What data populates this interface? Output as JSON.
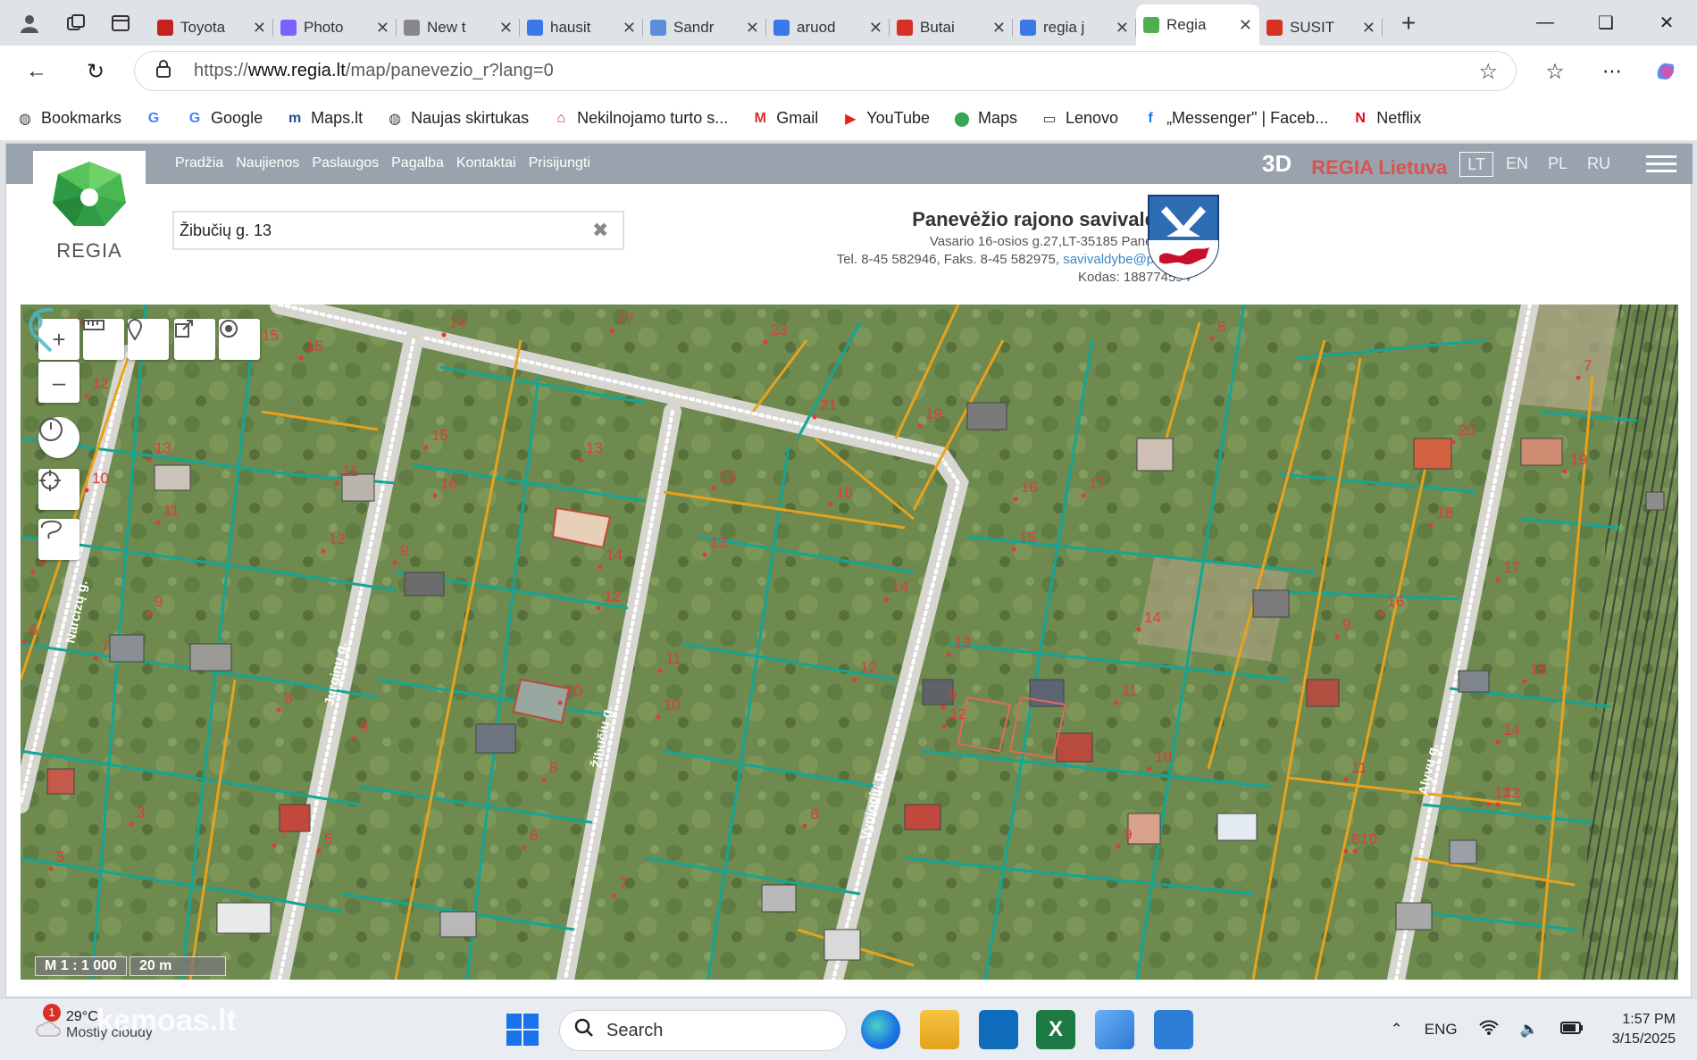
{
  "browser": {
    "tabs": [
      {
        "title": "Toyota",
        "fav": "#c5221f"
      },
      {
        "title": "Photo",
        "fav": "#7b61ff"
      },
      {
        "title": "New t",
        "fav": "#888888"
      },
      {
        "title": "hausit",
        "fav": "#3b78e7"
      },
      {
        "title": "Sandr",
        "fav": "#5a8fd8"
      },
      {
        "title": "aruod",
        "fav": "#3b78e7"
      },
      {
        "title": "Butai",
        "fav": "#d93025"
      },
      {
        "title": "regia j",
        "fav": "#3b78e7"
      },
      {
        "title": "Regia",
        "fav": "#4caf50"
      },
      {
        "title": "SUSIT",
        "fav": "#d93025"
      }
    ],
    "active_tab_index": 8,
    "url_prefix": "https://",
    "url_host": "www.regia.lt",
    "url_path": "/map/panevezio_r?lang=0",
    "bookmarks": [
      {
        "label": "Bookmarks",
        "icon": "globe-icon",
        "glyph": "◍",
        "color": "#444444"
      },
      {
        "label": "",
        "icon": "google-icon",
        "glyph": "G",
        "color": "#4285f4"
      },
      {
        "label": "Google",
        "icon": "google-icon",
        "glyph": "G",
        "color": "#4285f4"
      },
      {
        "label": "Maps.lt",
        "icon": "maps-lt-icon",
        "glyph": "m",
        "color": "#1f4e9e"
      },
      {
        "label": "Naujas skirtukas",
        "icon": "globe-icon",
        "glyph": "◍",
        "color": "#444444"
      },
      {
        "label": "Nekilnojamo turto s...",
        "icon": "house-icon",
        "glyph": "⌂",
        "color": "#d93025"
      },
      {
        "label": "Gmail",
        "icon": "gmail-icon",
        "glyph": "M",
        "color": "#d93025"
      },
      {
        "label": "YouTube",
        "icon": "youtube-icon",
        "glyph": "▶",
        "color": "#e62117"
      },
      {
        "label": "Maps",
        "icon": "maps-pin-icon",
        "glyph": "⬤",
        "color": "#34a853"
      },
      {
        "label": "Lenovo",
        "icon": "folder-icon",
        "glyph": "▭",
        "color": "#444444"
      },
      {
        "label": "„Messenger\" | Faceb...",
        "icon": "facebook-icon",
        "glyph": "f",
        "color": "#1877f2"
      },
      {
        "label": "Netflix",
        "icon": "netflix-icon",
        "glyph": "N",
        "color": "#e50914"
      }
    ]
  },
  "site": {
    "logo_text": "REGIA",
    "menu": [
      "Pradžia",
      "Naujienos",
      "Paslaugos",
      "Pagalba",
      "Kontaktai",
      "Prisijungti"
    ],
    "mode_3d": "3D",
    "brand": "REGIA Lietuva",
    "languages": [
      "LT",
      "EN",
      "PL",
      "RU"
    ],
    "active_language": "LT",
    "search_value": "Žibučių g. 13",
    "municipality": {
      "name": "Panevėžio rajono savivaldybė",
      "address": "Vasario 16-osios g.27,LT-35185 Panevėžys,",
      "phones": "Tel. 8-45 582946, Faks. 8-45 582975,",
      "email": "savivaldybe@panrs.lt",
      "code": "Kodas: 188774594"
    },
    "scale": "M 1 : 1 000",
    "scale_bar": "20 m",
    "streets": [
      "Narcizų g.",
      "Jurginų g.",
      "Žibučių g.",
      "Vyniogių g.",
      "Alyvų g."
    ],
    "parcel_numbers": [
      "14",
      "15",
      "16",
      "12",
      "13",
      "10",
      "11",
      "8",
      "9",
      "6",
      "7",
      "5",
      "3",
      "14",
      "12",
      "11",
      "9",
      "8",
      "7",
      "6",
      "5",
      "15",
      "16",
      "13",
      "14",
      "12",
      "10",
      "8",
      "6",
      "27",
      "23",
      "21",
      "19",
      "16",
      "15",
      "13",
      "14",
      "12",
      "11",
      "10",
      "9",
      "8",
      "7",
      "17",
      "15",
      "16",
      "14",
      "13",
      "12",
      "11",
      "10",
      "9",
      "8",
      "7",
      "20",
      "19",
      "18",
      "17",
      "16",
      "15",
      "14",
      "13",
      "12",
      "11",
      "10",
      "9",
      "8"
    ]
  },
  "taskbar": {
    "temperature": "29°C",
    "condition": "Mostly cloudy",
    "weather_badge": "1",
    "watermark": "kemoas.lt",
    "search_placeholder": "Search",
    "language": "ENG",
    "time": "1:57 PM",
    "date": "3/15/2025"
  }
}
